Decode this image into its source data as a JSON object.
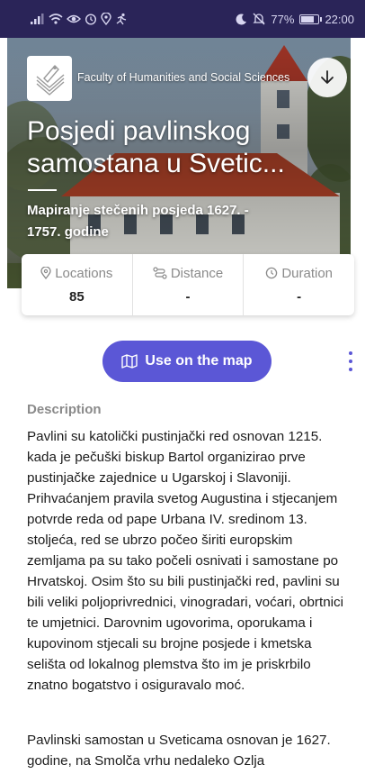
{
  "status_bar": {
    "battery": "77%",
    "time": "22:00",
    "battery_level": 0.77
  },
  "header": {
    "faculty_name": "Faculty of Humanities and Social Sciences",
    "title": "Posjedi pavlinskog samostana u Svetic...",
    "subtitle": "Mapiranje stečenih posjeda 1627. - 1757. godine"
  },
  "stats": [
    {
      "icon": "location-pin-icon",
      "label": "Locations",
      "value": "85"
    },
    {
      "icon": "route-icon",
      "label": "Distance",
      "value": "-"
    },
    {
      "icon": "clock-icon",
      "label": "Duration",
      "value": "-"
    }
  ],
  "actions": {
    "map_button_label": "Use on the map"
  },
  "description": {
    "heading": "Description",
    "paragraph_1": "Pavlini su katolički pustinjački red osnovan 1215. kada je pečuški biskup Bartol organizirao prve pustinjačke zajednice u Ugarskoj i Slavoniji. Prihvaćanjem pravila svetog Augustina i stjecanjem potvrde reda od pape Urbana IV. sredinom 13. stoljeća, red se ubrzo počeo širiti europskim zemljama pa su tako počeli osnivati i samostane po Hrvatskoj. Osim što su bili pustinjački red, pavlini su bili veliki poljoprivrednici, vinogradari, voćari, obrtnici te umjetnici. Darovnim ugovorima, oporukama i kupovinom stjecali su brojne posjede i kmetska selišta od lokalnog plemstva što im je priskrbilo znatno bogatstvo i osiguravalo moć.",
    "paragraph_2": "Pavlinski samostan u Sveticama osnovan je 1627. godine, na Smolča vrhu nedaleko Ozlja"
  }
}
